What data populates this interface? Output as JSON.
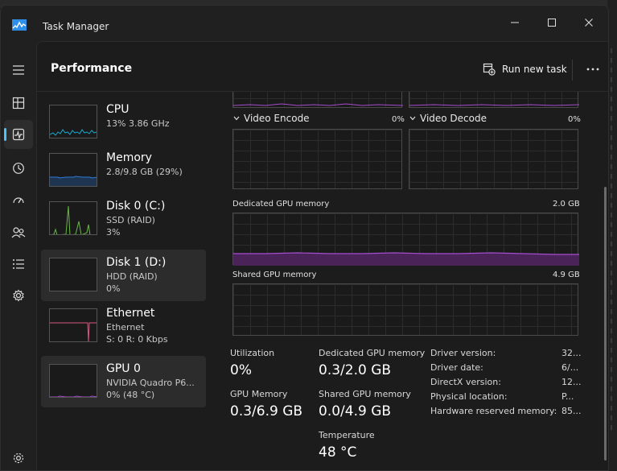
{
  "window": {
    "title": "Task Manager",
    "minimize_icon": "minimize-icon",
    "maximize_icon": "maximize-icon",
    "close_icon": "close-icon"
  },
  "nav": {
    "items": [
      {
        "icon": "hamburger-icon"
      },
      {
        "icon": "processes-icon"
      },
      {
        "icon": "performance-icon",
        "active": true
      },
      {
        "icon": "app-history-icon"
      },
      {
        "icon": "startup-apps-icon"
      },
      {
        "icon": "users-icon"
      },
      {
        "icon": "details-icon"
      },
      {
        "icon": "services-icon"
      }
    ],
    "settings_icon": "settings-icon"
  },
  "header": {
    "title": "Performance",
    "run_new_task": "Run new task",
    "more_icon": "more-options-icon"
  },
  "devices": [
    {
      "name": "CPU",
      "sub1": "13% 3.86 GHz",
      "sub2": "",
      "sub3": "",
      "color": "#17a8cf"
    },
    {
      "name": "Memory",
      "sub1": "2.8/9.8 GB (29%)",
      "sub2": "",
      "sub3": "",
      "color": "#2e7bd6"
    },
    {
      "name": "Disk 0 (C:)",
      "sub1": "SSD (RAID)",
      "sub2": "3%",
      "sub3": "",
      "color": "#6ab547"
    },
    {
      "name": "Disk 1 (D:)",
      "sub1": "HDD (RAID)",
      "sub2": "0%",
      "sub3": "",
      "color": "#6ab547"
    },
    {
      "name": "Ethernet",
      "sub1": "Ethernet",
      "sub2": "S: 0 R: 0 Kbps",
      "sub3": "",
      "color": "#d9577f"
    },
    {
      "name": "GPU 0",
      "sub1": "NVIDIA Quadro P6...",
      "sub2": "0% (48 °C)",
      "sub3": "",
      "color": "#a64ccf"
    }
  ],
  "gpu": {
    "video_encode_label": "Video Encode",
    "video_encode_pct": "0%",
    "video_decode_label": "Video Decode",
    "video_decode_pct": "0%",
    "dedicated_label": "Dedicated GPU memory",
    "dedicated_max": "2.0 GB",
    "shared_label": "Shared GPU memory",
    "shared_max": "4.9 GB",
    "accent": "#a64ccf",
    "stats": {
      "utilization_label": "Utilization",
      "utilization_value": "0%",
      "dedicated_label": "Dedicated GPU memory",
      "dedicated_value": "0.3/2.0 GB",
      "gpu_memory_label": "GPU Memory",
      "gpu_memory_value": "0.3/6.9 GB",
      "shared_label": "Shared GPU memory",
      "shared_value": "0.0/4.9 GB",
      "temperature_label": "Temperature",
      "temperature_value": "48 °C"
    },
    "info": [
      {
        "key": "Driver version:",
        "value": "32..."
      },
      {
        "key": "Driver date:",
        "value": "6/..."
      },
      {
        "key": "DirectX version:",
        "value": "12..."
      },
      {
        "key": "Physical location:",
        "value": "P..."
      },
      {
        "key": "Hardware reserved memory:",
        "value": "85..."
      }
    ]
  }
}
